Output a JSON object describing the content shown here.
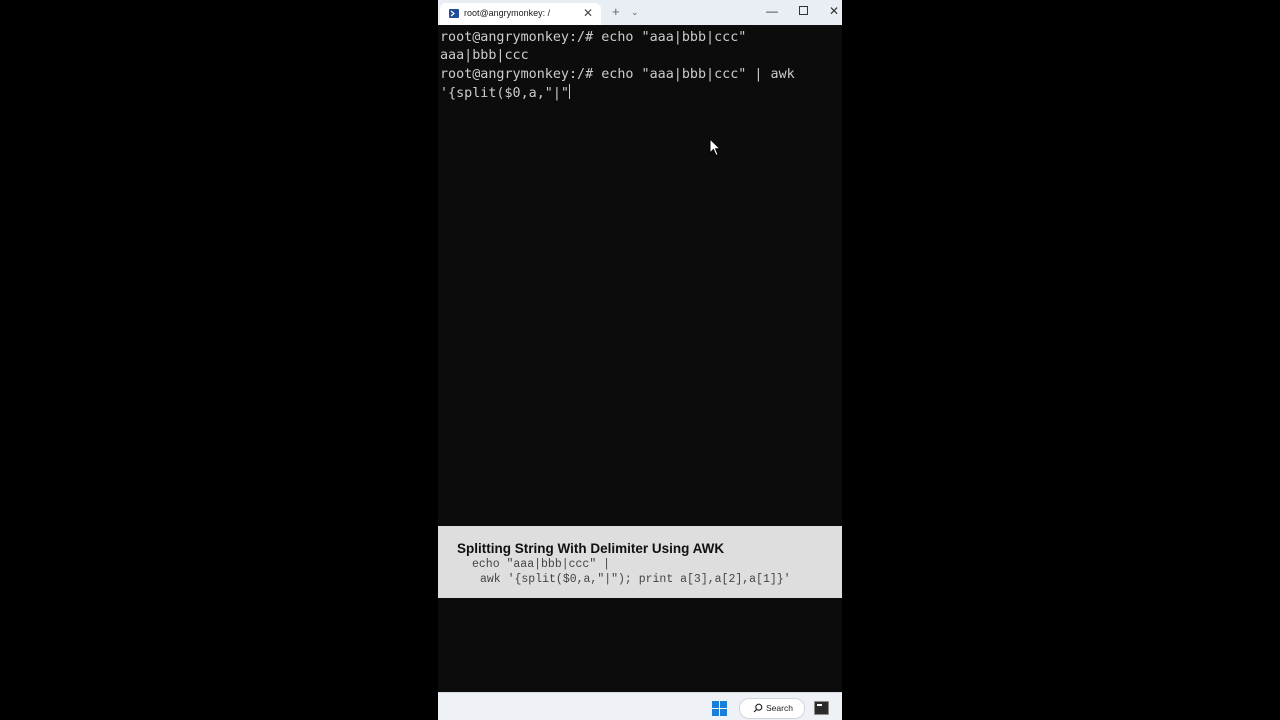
{
  "window": {
    "tab_title": "root@angrymonkey: /",
    "tab_close": "✕",
    "new_tab": "+",
    "tab_dropdown": "⌄",
    "minimize": "—",
    "close": "✕"
  },
  "terminal": {
    "lines": [
      "root@angrymonkey:/# echo \"aaa|bbb|ccc\"",
      "aaa|bbb|ccc",
      "root@angrymonkey:/# echo \"aaa|bbb|ccc\" | awk",
      "'{split($0,a,\"|\""
    ],
    "background": "#0c0c0c",
    "foreground": "#cccccc"
  },
  "caption": {
    "title": "Splitting String With Delimiter Using AWK",
    "code_line_1": "echo \"aaa|bbb|ccc\" |",
    "code_line_2": "awk '{split($0,a,\"|\"); print a[3],a[2],a[1]}'"
  },
  "taskbar": {
    "search_label": "Search",
    "accent": "#1a7fd9"
  },
  "icons": {
    "tab_icon": "powershell-icon",
    "start": "windows-start-icon",
    "search": "search-icon",
    "terminal_app": "terminal-app-icon",
    "pointer": "mouse-pointer-icon"
  }
}
